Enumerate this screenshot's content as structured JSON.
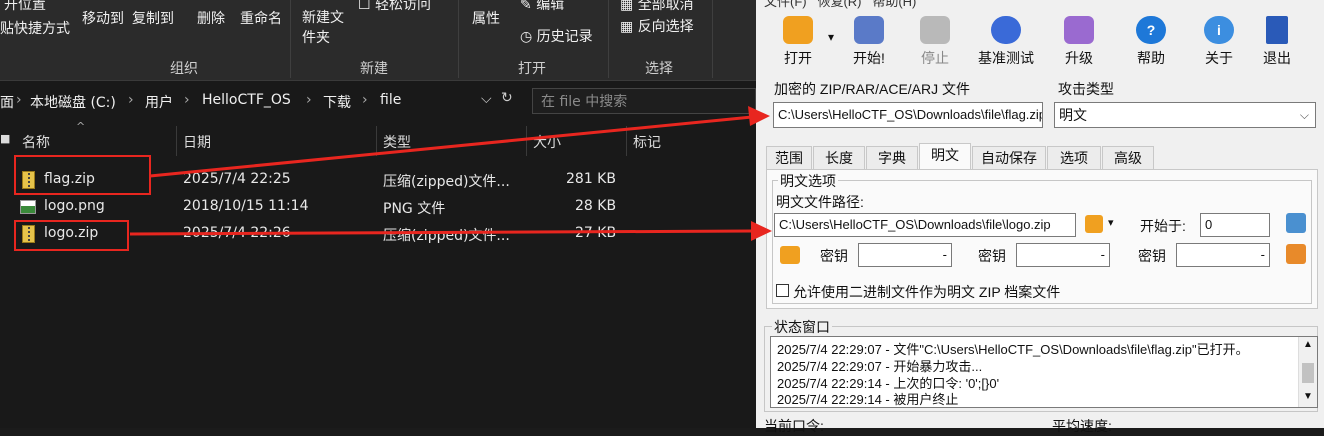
{
  "ribbon": {
    "row1": {
      "open_location": "开位置",
      "shortcut": "贴快捷方式",
      "move_to": "移动到",
      "copy_to": "复制到",
      "delete": "删除",
      "rename": "重命名",
      "new_folder": "新建文件夹",
      "easy_access": "轻松访问",
      "properties": "属性",
      "edit": "编辑",
      "history": "历史记录",
      "select_all": "全部取消",
      "invert": "反向选择"
    },
    "groups": {
      "organize": "组织",
      "new": "新建",
      "open": "打开",
      "select": "选择"
    }
  },
  "address": {
    "crumbs": [
      "面",
      "本地磁盘 (C:)",
      "用户",
      "HelloCTF_OS",
      "下载",
      "file"
    ],
    "search_placeholder": "在 file 中搜索"
  },
  "columns": {
    "name": "名称",
    "date": "日期",
    "type": "类型",
    "size": "大小",
    "tags": "标记"
  },
  "files": [
    {
      "name": "flag.zip",
      "date": "2025/7/4 22:25",
      "type": "压缩(zipped)文件...",
      "size": "281 KB",
      "icon": "zip-icon"
    },
    {
      "name": "logo.png",
      "date": "2018/10/15 11:14",
      "type": "PNG 文件",
      "size": "28 KB",
      "icon": "png-icon"
    },
    {
      "name": "logo.zip",
      "date": "2025/7/4 22:26",
      "type": "压缩(zipped)文件...",
      "size": "27 KB",
      "icon": "zip-icon"
    }
  ],
  "archpr": {
    "menu": {
      "file": "文件(F)",
      "recover": "恢复(R)",
      "help": "帮助(H)"
    },
    "toolbar": {
      "open": "打开",
      "start": "开始!",
      "stop": "停止",
      "benchmark": "基准测试",
      "upgrade": "升级",
      "help": "帮助",
      "about": "关于",
      "exit": "退出"
    },
    "encrypted_label": "加密的 ZIP/RAR/ACE/ARJ 文件",
    "encrypted_path": "C:\\Users\\HelloCTF_OS\\Downloads\\file\\flag.zip",
    "attack_type_label": "攻击类型",
    "attack_type": "明文",
    "tabs": [
      "范围",
      "长度",
      "字典",
      "明文",
      "自动保存",
      "选项",
      "高级"
    ],
    "active_tab": "明文",
    "plaintext_options": "明文选项",
    "plaintext_path_label": "明文文件路径:",
    "plaintext_path": "C:\\Users\\HelloCTF_OS\\Downloads\\file\\logo.zip",
    "start_at_label": "开始于:",
    "start_at": "0",
    "key_label": "密钥",
    "allow_binary": "允许使用二进制文件作为明文 ZIP 档案文件",
    "status_window": "状态窗口",
    "log": [
      "2025/7/4 22:29:07 - 文件\"C:\\Users\\HelloCTF_OS\\Downloads\\file\\flag.zip\"已打开。",
      "2025/7/4 22:29:07 - 开始暴力攻击...",
      "2025/7/4 22:29:14 - 上次的口令: '0';[}0'",
      "2025/7/4 22:29:14 - 被用户终止"
    ],
    "current_password": "当前口令:",
    "avg_speed": "平均速度:"
  },
  "colors": {
    "highlight": "#e8261f",
    "explorer_bg": "#191919",
    "archpr_bg": "#f0f0f0"
  }
}
